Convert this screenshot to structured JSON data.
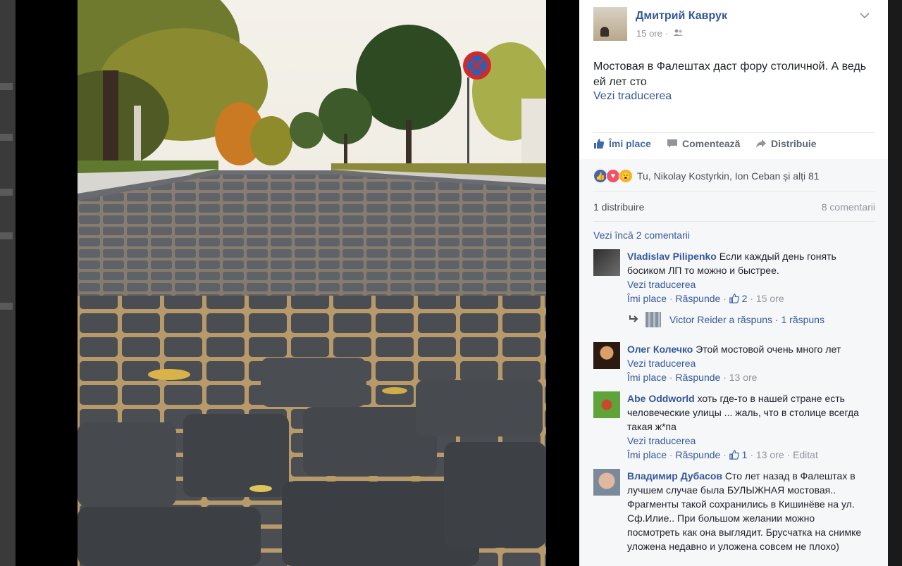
{
  "post": {
    "author": "Дмитрий Каврук",
    "time": "15 ore",
    "audience_icon": "friends-icon",
    "text": "Мостовая в Фалештах даст фору столичной. А ведь ей лет сто",
    "translate": "Vezi traducerea"
  },
  "actions": {
    "like": "Îmi place",
    "comment": "Comentează",
    "share": "Distribuie"
  },
  "reactions": {
    "summary": "Tu, Nikolay Kostyrkin, Ion Ceban și alți 81"
  },
  "stats": {
    "shares": "1 distribuire",
    "comments": "8 comentarii"
  },
  "more_comments": "Vezi încă 2 comentarii",
  "comments": [
    {
      "name": "Vladislav Pilipenko",
      "text": "Если каждый день гонять босиком ЛП то можно и быстрее.",
      "translate": "Vezi traducerea",
      "like": "Îmi place",
      "reply": "Răspunde",
      "likes": "2",
      "time": "15 ore"
    },
    {
      "name": "Олег Колечко",
      "text": "Этой мостовой очень много лет",
      "translate": "Vezi traducerea",
      "like": "Îmi place",
      "reply": "Răspunde",
      "time": "13 ore"
    },
    {
      "name": "Abe Oddworld",
      "text": "хоть где-то в нашей стране есть человеческие улицы ... жаль, что в столице всегда такая ж*па",
      "translate": "Vezi traducerea",
      "like": "Îmi place",
      "reply": "Răspunde",
      "likes": "1",
      "time": "13 ore",
      "edited": "Editat"
    },
    {
      "name": "Владимир Дубасов",
      "text": "Сто лет назад в Фалештах в лучшем случае была БУЛЫЖНАЯ мостовая.. Фрагменты такой сохранились в Кишинёве на ул. Сф.Илие.. При большом желании можно посмотреть как она выглядит. Брусчатка на снимке уложена недавно и уложена совсем не плохо)"
    }
  ],
  "reply": {
    "text": "Victor Reider a răspuns · 1 răspuns"
  },
  "colors": {
    "link": "#365899",
    "meta": "#90949c",
    "panel_gray": "#f6f7f9"
  }
}
